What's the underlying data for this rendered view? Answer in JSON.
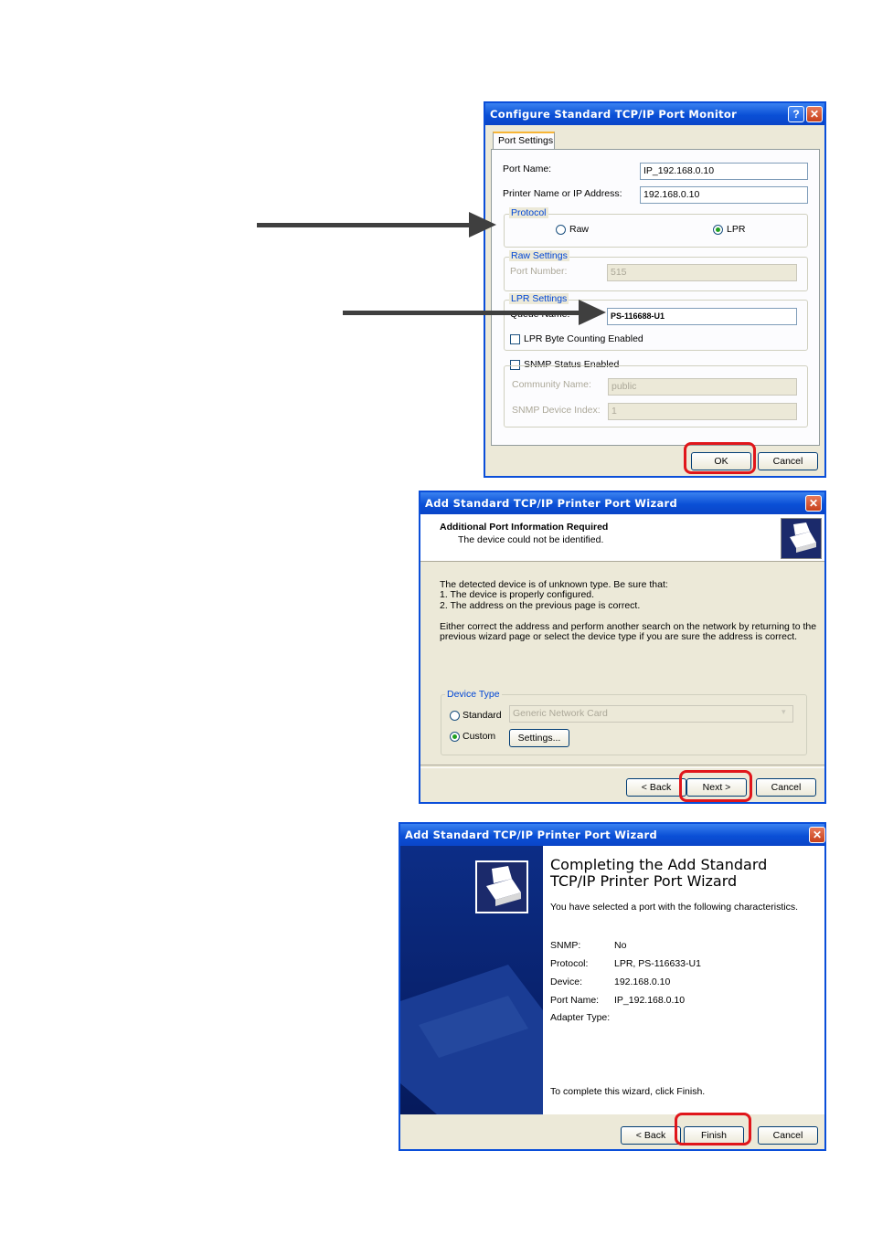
{
  "dialog1": {
    "title": "Configure Standard TCP/IP Port Monitor",
    "help_btn": "?",
    "close_btn": "✕",
    "tab": "Port Settings",
    "port_name_label": "Port Name:",
    "port_name_value": "IP_192.168.0.10",
    "printer_name_label": "Printer Name or IP Address:",
    "printer_name_value": "192.168.0.10",
    "protocol_title": "Protocol",
    "raw_label": "Raw",
    "lpr_label": "LPR",
    "raw_settings_title": "Raw Settings",
    "port_number_label": "Port Number:",
    "port_number_value": "515",
    "lpr_settings_title": "LPR Settings",
    "queue_name_label": "Queue Name:",
    "queue_name_value": "PS-116688-U1",
    "lpr_byte_counting": "LPR Byte Counting Enabled",
    "snmp_status": "SNMP Status Enabled",
    "community_label": "Community Name:",
    "community_value": "public",
    "snmp_index_label": "SNMP Device Index:",
    "snmp_index_value": "1",
    "ok": "OK",
    "cancel": "Cancel"
  },
  "dialog2": {
    "title": "Add Standard TCP/IP Printer Port Wizard",
    "close_btn": "✕",
    "heading": "Additional Port Information Required",
    "subheading": "The device could not be identified.",
    "body_lines": [
      "The detected device is of unknown type.  Be sure that:",
      "1. The device is properly configured.",
      "2.  The address on the previous page is correct."
    ],
    "body_lines2": [
      "Either correct the address and perform another search on the network by returning to the",
      "previous wizard page or select the device type if you are sure the address is correct."
    ],
    "device_type_title": "Device Type",
    "standard_label": "Standard",
    "standard_value": "Generic Network Card",
    "custom_label": "Custom",
    "settings_btn": "Settings...",
    "back": "< Back",
    "next": "Next >",
    "cancel": "Cancel"
  },
  "dialog3": {
    "title": "Add Standard TCP/IP Printer Port Wizard",
    "close_btn": "✕",
    "heading_line1": "Completing the Add Standard",
    "heading_line2": "TCP/IP Printer Port Wizard",
    "intro": "You have selected a port with the following characteristics.",
    "rows": [
      {
        "k": "SNMP:",
        "v": "No"
      },
      {
        "k": "Protocol:",
        "v": "LPR,  PS-116633-U1"
      },
      {
        "k": "Device:",
        "v": "192.168.0.10"
      },
      {
        "k": "Port Name:",
        "v": "IP_192.168.0.10"
      },
      {
        "k": "Adapter Type:",
        "v": ""
      }
    ],
    "finish_note": "To complete this wizard, click Finish.",
    "back": "< Back",
    "finish": "Finish",
    "cancel": "Cancel"
  },
  "colors": {
    "highlight_ring": "#e0161b",
    "title_bar": "#0a4fd6",
    "wizard_side": "#0b2a7a"
  }
}
